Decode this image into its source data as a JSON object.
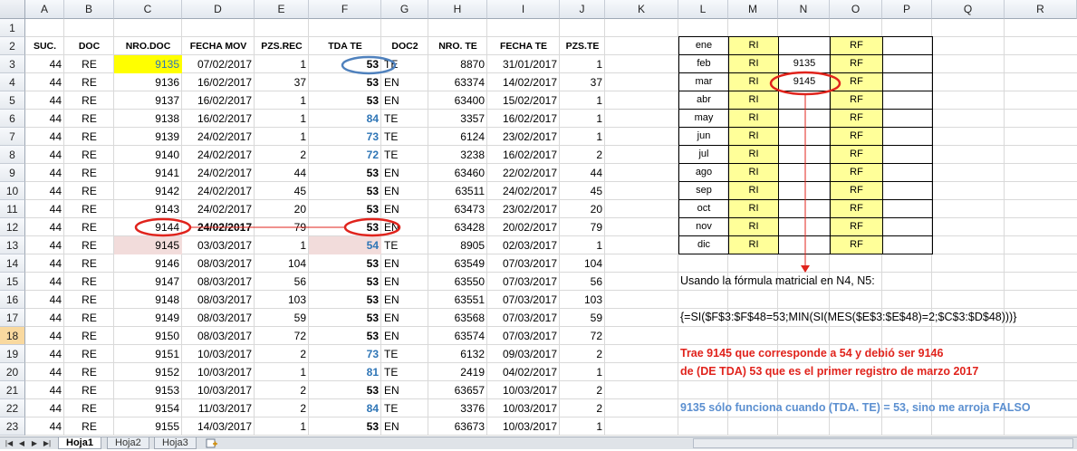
{
  "sheet": {
    "columns": [
      "A",
      "B",
      "C",
      "D",
      "E",
      "F",
      "G",
      "H",
      "I",
      "J",
      "K",
      "L",
      "M",
      "N",
      "O",
      "P",
      "Q",
      "R"
    ],
    "row_numbers": [
      "1",
      "2",
      "3",
      "4",
      "5",
      "6",
      "7",
      "8",
      "9",
      "10",
      "11",
      "12",
      "13",
      "14",
      "15",
      "16",
      "17",
      "18",
      "19",
      "20",
      "21",
      "22",
      "23"
    ],
    "headers": [
      "SUC.",
      "DOC",
      "NRO.DOC",
      "FECHA MOV",
      "PZS.REC",
      "TDA TE",
      "DOC2",
      "NRO. TE",
      "FECHA TE",
      "PZS.TE"
    ],
    "rows": [
      [
        "44",
        "RE",
        "9135",
        "07/02/2017",
        "1",
        "53",
        "TE",
        "8870",
        "31/01/2017",
        "1"
      ],
      [
        "44",
        "RE",
        "9136",
        "16/02/2017",
        "37",
        "53",
        "EN",
        "63374",
        "14/02/2017",
        "37"
      ],
      [
        "44",
        "RE",
        "9137",
        "16/02/2017",
        "1",
        "53",
        "EN",
        "63400",
        "15/02/2017",
        "1"
      ],
      [
        "44",
        "RE",
        "9138",
        "16/02/2017",
        "1",
        "84",
        "TE",
        "3357",
        "16/02/2017",
        "1"
      ],
      [
        "44",
        "RE",
        "9139",
        "24/02/2017",
        "1",
        "73",
        "TE",
        "6124",
        "23/02/2017",
        "1"
      ],
      [
        "44",
        "RE",
        "9140",
        "24/02/2017",
        "2",
        "72",
        "TE",
        "3238",
        "16/02/2017",
        "2"
      ],
      [
        "44",
        "RE",
        "9141",
        "24/02/2017",
        "44",
        "53",
        "EN",
        "63460",
        "22/02/2017",
        "44"
      ],
      [
        "44",
        "RE",
        "9142",
        "24/02/2017",
        "45",
        "53",
        "EN",
        "63511",
        "24/02/2017",
        "45"
      ],
      [
        "44",
        "RE",
        "9143",
        "24/02/2017",
        "20",
        "53",
        "EN",
        "63473",
        "23/02/2017",
        "20"
      ],
      [
        "44",
        "RE",
        "9144",
        "24/02/2017",
        "79",
        "53",
        "EN",
        "63428",
        "20/02/2017",
        "79"
      ],
      [
        "44",
        "RE",
        "9145",
        "03/03/2017",
        "1",
        "54",
        "TE",
        "8905",
        "02/03/2017",
        "1"
      ],
      [
        "44",
        "RE",
        "9146",
        "08/03/2017",
        "104",
        "53",
        "EN",
        "63549",
        "07/03/2017",
        "104"
      ],
      [
        "44",
        "RE",
        "9147",
        "08/03/2017",
        "56",
        "53",
        "EN",
        "63550",
        "07/03/2017",
        "56"
      ],
      [
        "44",
        "RE",
        "9148",
        "08/03/2017",
        "103",
        "53",
        "EN",
        "63551",
        "07/03/2017",
        "103"
      ],
      [
        "44",
        "RE",
        "9149",
        "08/03/2017",
        "59",
        "53",
        "EN",
        "63568",
        "07/03/2017",
        "59"
      ],
      [
        "44",
        "RE",
        "9150",
        "08/03/2017",
        "72",
        "53",
        "EN",
        "63574",
        "07/03/2017",
        "72"
      ],
      [
        "44",
        "RE",
        "9151",
        "10/03/2017",
        "2",
        "73",
        "TE",
        "6132",
        "09/03/2017",
        "2"
      ],
      [
        "44",
        "RE",
        "9152",
        "10/03/2017",
        "1",
        "81",
        "TE",
        "2419",
        "04/02/2017",
        "1"
      ],
      [
        "44",
        "RE",
        "9153",
        "10/03/2017",
        "2",
        "53",
        "EN",
        "63657",
        "10/03/2017",
        "2"
      ],
      [
        "44",
        "RE",
        "9154",
        "11/03/2017",
        "2",
        "84",
        "TE",
        "3376",
        "10/03/2017",
        "2"
      ],
      [
        "44",
        "RE",
        "9155",
        "14/03/2017",
        "1",
        "53",
        "EN",
        "63673",
        "10/03/2017",
        "1"
      ]
    ],
    "month_table": [
      {
        "month": "ene",
        "ri": "RI",
        "n": "",
        "rf": "RF"
      },
      {
        "month": "feb",
        "ri": "RI",
        "n": "9135",
        "rf": "RF"
      },
      {
        "month": "mar",
        "ri": "RI",
        "n": "9145",
        "rf": "RF"
      },
      {
        "month": "abr",
        "ri": "RI",
        "n": "",
        "rf": "RF"
      },
      {
        "month": "may",
        "ri": "RI",
        "n": "",
        "rf": "RF"
      },
      {
        "month": "jun",
        "ri": "RI",
        "n": "",
        "rf": "RF"
      },
      {
        "month": "jul",
        "ri": "RI",
        "n": "",
        "rf": "RF"
      },
      {
        "month": "ago",
        "ri": "RI",
        "n": "",
        "rf": "RF"
      },
      {
        "month": "sep",
        "ri": "RI",
        "n": "",
        "rf": "RF"
      },
      {
        "month": "oct",
        "ri": "RI",
        "n": "",
        "rf": "RF"
      },
      {
        "month": "nov",
        "ri": "RI",
        "n": "",
        "rf": "RF"
      },
      {
        "month": "dic",
        "ri": "RI",
        "n": "",
        "rf": "RF"
      }
    ],
    "notes": {
      "formula_intro": "Usando la fórmula matricial en N4, N5:",
      "formula": "{=SI($F$3:$F$48=53;MIN(SI(MES($E$3:$E$48)=2;$C$3:$D$48)))}",
      "problem_line1": "Trae 9145 que corresponde a 54 y debió ser 9146",
      "problem_line2": "de (DE TDA) 53 que es el primer registro de marzo 2017",
      "info": "9135 sólo funciona cuando (TDA. TE) = 53, sino me arroja FALSO"
    },
    "colors": {
      "highlight_yellow": "#ffff00",
      "highlight_pink": "#f2dcdb",
      "table_fill": "#ffff99",
      "annotation_red": "#e0231c",
      "annotation_blue": "#4f81bd",
      "blue_text": "#2e75b6"
    }
  },
  "tabs": {
    "items": [
      "Hoja1",
      "Hoja2",
      "Hoja3"
    ],
    "active": "Hoja1",
    "new_sheet_icon": "insert-sheet-icon",
    "nav_icons": [
      "first-sheet-icon",
      "prev-sheet-icon",
      "next-sheet-icon",
      "last-sheet-icon"
    ]
  }
}
